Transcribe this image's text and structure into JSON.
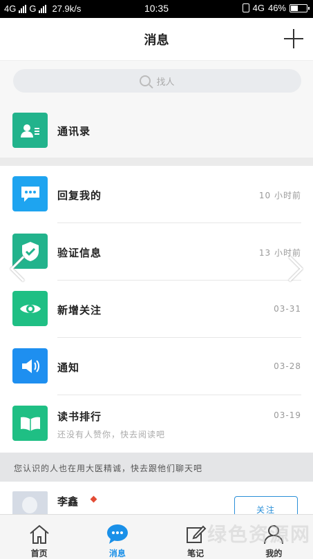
{
  "status_bar": {
    "network_left": "4G",
    "network_mid": "G",
    "speed": "27.9k/s",
    "time": "10:35",
    "network_right": "4G",
    "battery": "46%",
    "battery_level": 0.46
  },
  "header": {
    "title": "消息",
    "add_icon": "plus-icon"
  },
  "search": {
    "placeholder": "找人",
    "icon": "search-icon"
  },
  "contacts": {
    "label": "通讯录",
    "icon": "contact-card-icon",
    "color": "#22b38c"
  },
  "messages": [
    {
      "label": "回复我的",
      "time": "10 小时前",
      "icon": "chat-bubble-icon",
      "color": "#1ea4f0"
    },
    {
      "label": "验证信息",
      "time": "13 小时前",
      "icon": "shield-check-icon",
      "color": "#22b38c"
    },
    {
      "label": "新增关注",
      "time": "03-31",
      "icon": "eye-icon",
      "color": "#1fbf84"
    },
    {
      "label": "通知",
      "time": "03-28",
      "icon": "speaker-icon",
      "color": "#1e8ff0"
    },
    {
      "label": "读书排行",
      "time": "03-19",
      "sub": "还没有人赞你，快去阅读吧",
      "icon": "book-icon",
      "color": "#1fbf84"
    }
  ],
  "notice": "您认识的人也在用大医精诚，快去跟他们聊天吧",
  "suggestion": {
    "name": "李鑫",
    "follow_label": "关注"
  },
  "tabs": [
    {
      "label": "首页",
      "icon": "home-icon",
      "active": false
    },
    {
      "label": "消息",
      "icon": "message-icon",
      "active": true
    },
    {
      "label": "笔记",
      "icon": "note-edit-icon",
      "active": false
    },
    {
      "label": "我的",
      "icon": "user-icon",
      "active": false
    }
  ],
  "watermark": "绿色资源网"
}
